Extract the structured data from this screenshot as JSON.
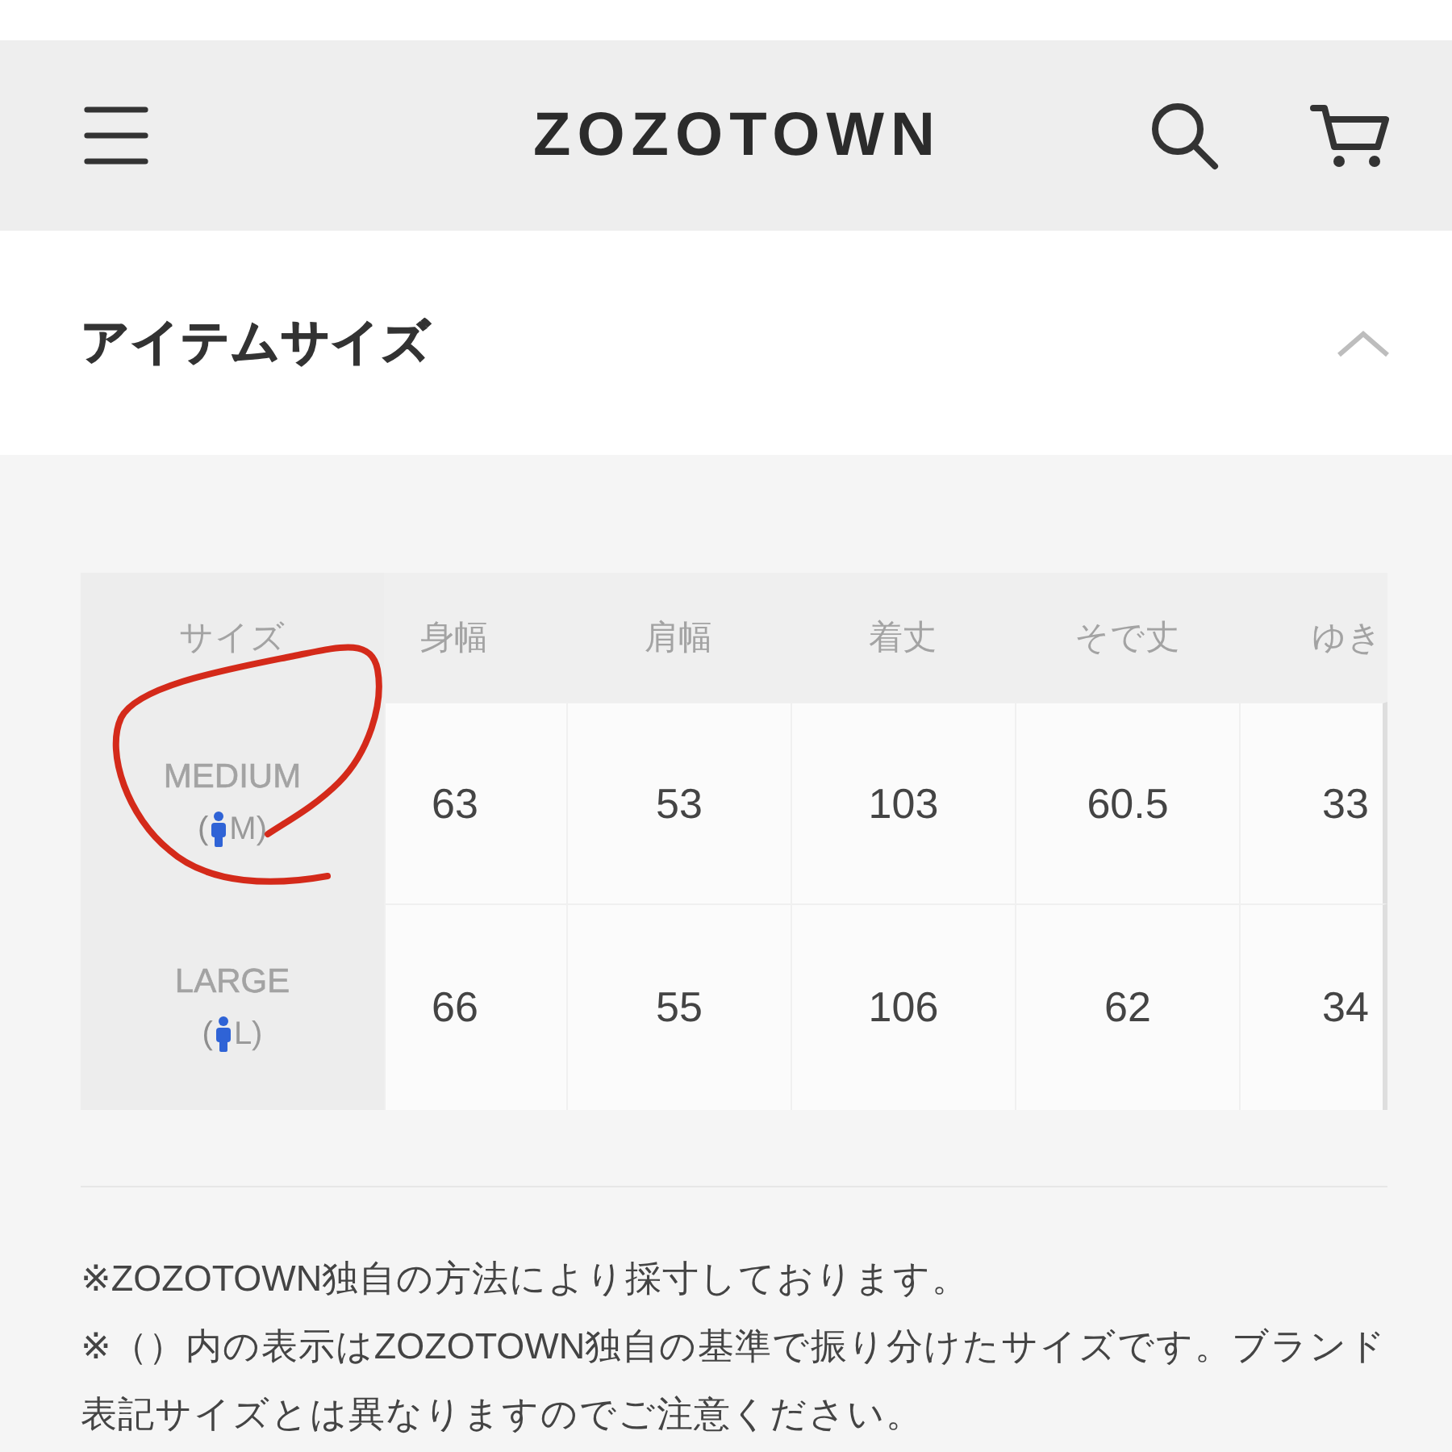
{
  "header": {
    "logo": "ZOZOTOWN"
  },
  "section": {
    "title": "アイテムサイズ",
    "expanded": true
  },
  "size_table": {
    "columns": [
      "サイズ",
      "身幅",
      "肩幅",
      "着丈",
      "そで丈",
      "ゆき"
    ],
    "rows": [
      {
        "size": "MEDIUM",
        "code_left": "(",
        "code_right": "M)",
        "circled": true,
        "values": [
          "63",
          "53",
          "103",
          "60.5",
          "33"
        ]
      },
      {
        "size": "LARGE",
        "code_left": "(",
        "code_right": "L)",
        "circled": false,
        "values": [
          "66",
          "55",
          "106",
          "62",
          "34"
        ]
      }
    ]
  },
  "notes": [
    "※ZOZOTOWN独自の方法により採寸しております。",
    "※（）内の表示はZOZOTOWN独自の基準で振り分けたサイズです。ブランド表記サイズとは異なりますのでご注意ください。"
  ]
}
